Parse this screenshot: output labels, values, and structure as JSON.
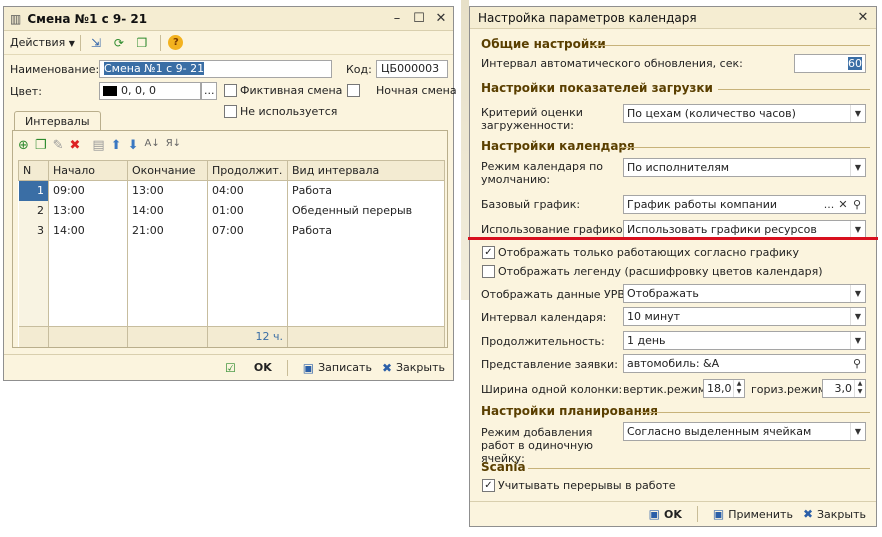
{
  "shift_window": {
    "title": "Смена №1 с 9- 21",
    "toolbar": {
      "actions_label": "Действия"
    },
    "fields": {
      "name_label": "Наименование:",
      "name_value": "Смена №1 с 9- 21",
      "code_label": "Код:",
      "code_value": "ЦБ000003",
      "color_label": "Цвет:",
      "color_value": "0, 0, 0",
      "fictive_label": "Фиктивная смена",
      "night_label": "Ночная смена",
      "unused_label": "Не используется"
    },
    "tab_label": "Интервалы",
    "table": {
      "headers": [
        "N",
        "Начало",
        "Окончание",
        "Продолжит.",
        "Вид интервала"
      ],
      "rows": [
        [
          "1",
          "09:00",
          "13:00",
          "04:00",
          "Работа"
        ],
        [
          "2",
          "13:00",
          "14:00",
          "01:00",
          "Обеденный перерыв"
        ],
        [
          "3",
          "14:00",
          "21:00",
          "07:00",
          "Работа"
        ]
      ],
      "total": "12 ч."
    },
    "footer": {
      "ok": "OK",
      "save": "Записать",
      "close": "Закрыть"
    }
  },
  "settings_window": {
    "title": "Настройка параметров календаря",
    "general": {
      "header": "Общие настройки",
      "interval_label": "Интервал автоматического обновления, сек:",
      "interval_value": "60"
    },
    "load": {
      "header": "Настройки показателей загрузки",
      "criterion_label": "Критерий оценки загруженности:",
      "criterion_value": "По цехам (количество часов)"
    },
    "calendar": {
      "header": "Настройки календаря",
      "mode_label": "Режим календаря по умолчанию:",
      "mode_value": "По исполнителям",
      "base_label": "Базовый график:",
      "base_value": "График работы компании",
      "usage_label": "Использование графиков:",
      "usage_value": "Использовать графики ресурсов",
      "only_working_label": "Отображать только работающих согласно графику",
      "legend_label": "Отображать легенду (расшифровку цветов календаря)",
      "urv_label": "Отображать данные УРВ:",
      "urv_value": "Отображать",
      "cal_interval_label": "Интервал календаря:",
      "cal_interval_value": "10 минут",
      "duration_label": "Продолжительность:",
      "duration_value": "1 день",
      "request_label": "Представление заявки:",
      "request_value": "автомобиль: &А",
      "width_label": "Ширина одной колонки:",
      "vert_label": "вертик.режим:",
      "vert_value": "18,0",
      "horiz_label": "гориз.режим:",
      "horiz_value": "3,0"
    },
    "planning": {
      "header": "Настройки планирования",
      "add_mode_label": "Режим добавления работ в одиночную ячейку:",
      "add_mode_value": "Согласно выделенным ячейкам"
    },
    "scania": {
      "header": "Scania",
      "breaks_label": "Учитывать перерывы в работе"
    },
    "footer": {
      "ok": "OK",
      "apply": "Применить",
      "close": "Закрыть"
    }
  },
  "colors": {
    "accent": "#3a6ea5",
    "section": "#5a3f00",
    "annotation": "#d8101e"
  }
}
